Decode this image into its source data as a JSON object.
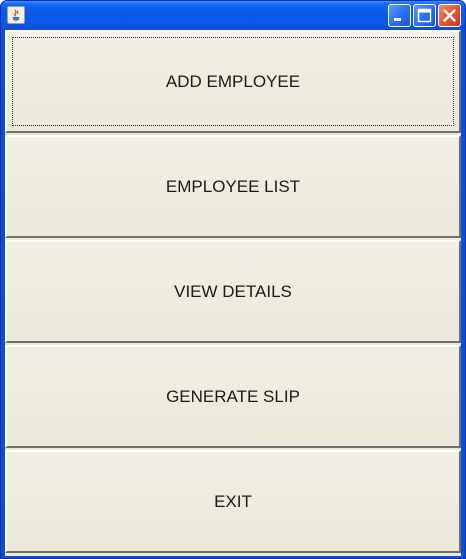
{
  "window": {
    "title": "",
    "icon": "java-cup-icon",
    "controls": [
      "minimize",
      "maximize",
      "close"
    ]
  },
  "menu": {
    "buttons": [
      {
        "label": "ADD EMPLOYEE",
        "focused": true
      },
      {
        "label": "EMPLOYEE LIST"
      },
      {
        "label": "VIEW DETAILS"
      },
      {
        "label": "GENERATE SLIP"
      },
      {
        "label": "EXIT"
      }
    ]
  },
  "colors": {
    "titlebar": "#0a5be8",
    "frame": "#0a4fd6",
    "panel": "#ece9d8",
    "close_button": "#e0532d"
  }
}
